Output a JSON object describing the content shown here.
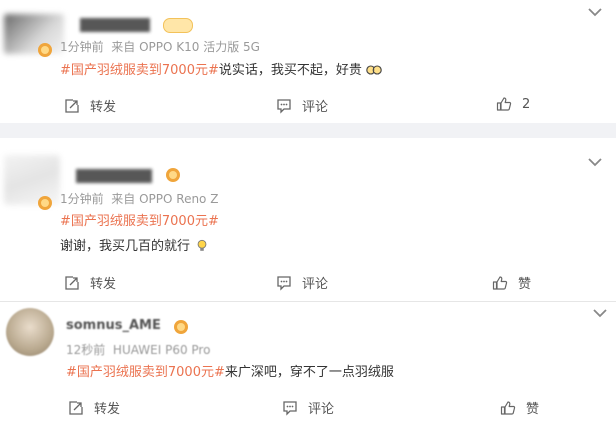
{
  "posts": [
    {
      "time": "1分钟前",
      "source": "来自 OPPO K10 活力版 5G",
      "topic": "#国产羽绒服卖到7000元#",
      "text": "说实话，我买不起，好贵",
      "repost_label": "转发",
      "comment_label": "评论",
      "like_count": "2"
    },
    {
      "time": "1分钟前",
      "source": "来自 OPPO Reno Z",
      "topic": "#国产羽绒服卖到7000元#",
      "text": "谢谢，我买几百的就行",
      "repost_label": "转发",
      "comment_label": "评论",
      "like_label": "赞"
    },
    {
      "username": "somnus_AME",
      "time": "12秒前",
      "source": "HUAWEI P60 Pro",
      "topic": "#国产羽绒服卖到7000元#",
      "text": "来广深吧，穿不了一点羽绒服",
      "repost_label": "转发",
      "comment_label": "评论",
      "like_label": "赞"
    }
  ],
  "colors": {
    "topic": "#eb7350",
    "meta": "#9a9a9a",
    "separator": "#f1f2f5",
    "vip_badge": "#f0a53b"
  },
  "icons": [
    "repost-icon",
    "comment-icon",
    "like-icon",
    "chevron-down-icon",
    "vip-badge-icon"
  ]
}
